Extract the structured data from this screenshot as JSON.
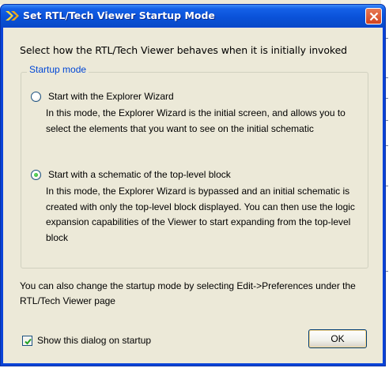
{
  "dialog": {
    "title": "Set RTL/Tech Viewer Startup Mode",
    "heading": "Select how the RTL/Tech Viewer behaves when it is initially invoked",
    "group_label": "Startup mode",
    "options": [
      {
        "label": "Start with the Explorer Wizard",
        "selected": false,
        "description": "In this mode, the Explorer Wizard is the initial screen, and allows you to select the elements that you want to see on the initial schematic"
      },
      {
        "label": "Start with a schematic of the top-level block",
        "selected": true,
        "description": "In this mode, the Explorer Wizard is bypassed and an initial schematic is created with only the top-level block displayed. You can then use the logic expansion capabilities of the Viewer to start expanding from the top-level block"
      }
    ],
    "note": "You can also change the startup mode by selecting Edit->Preferences under the RTL/Tech Viewer page",
    "show_on_startup_label": "Show this dialog on startup",
    "show_on_startup_checked": true,
    "ok_label": "OK"
  },
  "icons": {
    "title_icon": "xilinx-logo-icon",
    "close_icon": "close-icon"
  },
  "colors": {
    "titlebar": "#0a52d9",
    "client_bg": "#ece9d8",
    "group_label": "#0046d5",
    "close_button": "#d3431f"
  }
}
